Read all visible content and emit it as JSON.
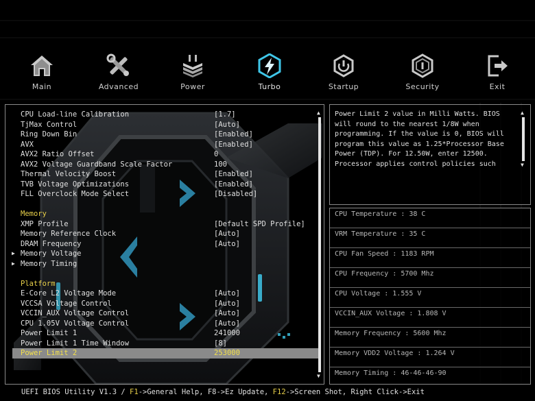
{
  "nav": {
    "items": [
      {
        "label": "Main",
        "icon": "home-icon"
      },
      {
        "label": "Advanced",
        "icon": "tools-icon"
      },
      {
        "label": "Power",
        "icon": "power-heatsink-icon"
      },
      {
        "label": "Turbo",
        "icon": "turbo-bolt-icon"
      },
      {
        "label": "Startup",
        "icon": "startup-power-icon"
      },
      {
        "label": "Security",
        "icon": "security-shield-icon"
      },
      {
        "label": "Exit",
        "icon": "exit-door-icon"
      }
    ],
    "active": "Turbo",
    "accent": "#3fc6e8"
  },
  "settings": {
    "rows": [
      {
        "label": "CPU Load-line Calibration",
        "value": "[1.7]"
      },
      {
        "label": "TjMax Control",
        "value": "[Auto]"
      },
      {
        "label": "Ring Down Bin",
        "value": "[Enabled]"
      },
      {
        "label": "AVX",
        "value": "[Enabled]"
      },
      {
        "label": "AVX2 Ratio Offset",
        "value": "0"
      },
      {
        "label": "AVX2 Voltage Guardband Scale Factor",
        "value": "100"
      },
      {
        "label": "Thermal Velocity Boost",
        "value": "[Enabled]"
      },
      {
        "label": "TVB Voltage Optimizations",
        "value": "[Enabled]"
      },
      {
        "label": "FLL Overclock Mode Select",
        "value": "[Disabled]"
      },
      {
        "label": "",
        "value": ""
      },
      {
        "label": "Memory",
        "value": "",
        "section": true
      },
      {
        "label": "XMP Profile",
        "value": "[Default SPD Profile]"
      },
      {
        "label": "Memory Reference Clock",
        "value": "[Auto]"
      },
      {
        "label": "DRAM Frequency",
        "value": "[Auto]"
      },
      {
        "label": "Memory Voltage",
        "value": "",
        "submenu": true
      },
      {
        "label": "Memory Timing",
        "value": "",
        "submenu": true
      },
      {
        "label": "",
        "value": ""
      },
      {
        "label": "Platform",
        "value": "",
        "section": true
      },
      {
        "label": "E-Core L2 Voltage Mode",
        "value": "[Auto]"
      },
      {
        "label": "VCCSA Voltage Control",
        "value": "[Auto]"
      },
      {
        "label": "VCCIN_AUX Voltage Control",
        "value": "[Auto]"
      },
      {
        "label": "CPU 1.05V Voltage Control",
        "value": "[Auto]"
      },
      {
        "label": "Power Limit 1",
        "value": "241000"
      },
      {
        "label": "Power Limit 1 Time Window",
        "value": "[8]"
      },
      {
        "label": "Power Limit 2",
        "value": "253000",
        "selected": true
      }
    ]
  },
  "help": {
    "text": "Power Limit 2 value in Milli Watts. BIOS\nwill round to the nearest 1/8W when\nprogramming. If the value is 0, BIOS will\nprogram this value as 1.25*Processor Base\nPower (TDP). For 12.50W, enter 12500.\nProcessor applies control policies such"
  },
  "monitor": {
    "items": [
      "CPU Temperature : 38 C",
      "VRM Temperature : 35 C",
      "CPU Fan Speed : 1183 RPM",
      "CPU Frequency : 5700 Mhz",
      "CPU Voltage : 1.555 V",
      "VCCIN_AUX Voltage : 1.808 V",
      "Memory Frequency : 5600 Mhz",
      "Memory VDD2 Voltage : 1.264 V",
      "Memory Timing : 46-46-46-90"
    ]
  },
  "footer": {
    "version": "UEFI BIOS Utility V1.3 / ",
    "f1_key": "F1",
    "f1_text": "->General Help, F8->Ez Update, ",
    "f12_key": "F12",
    "f12_text": "->Screen Shot, Right Click->Exit"
  }
}
